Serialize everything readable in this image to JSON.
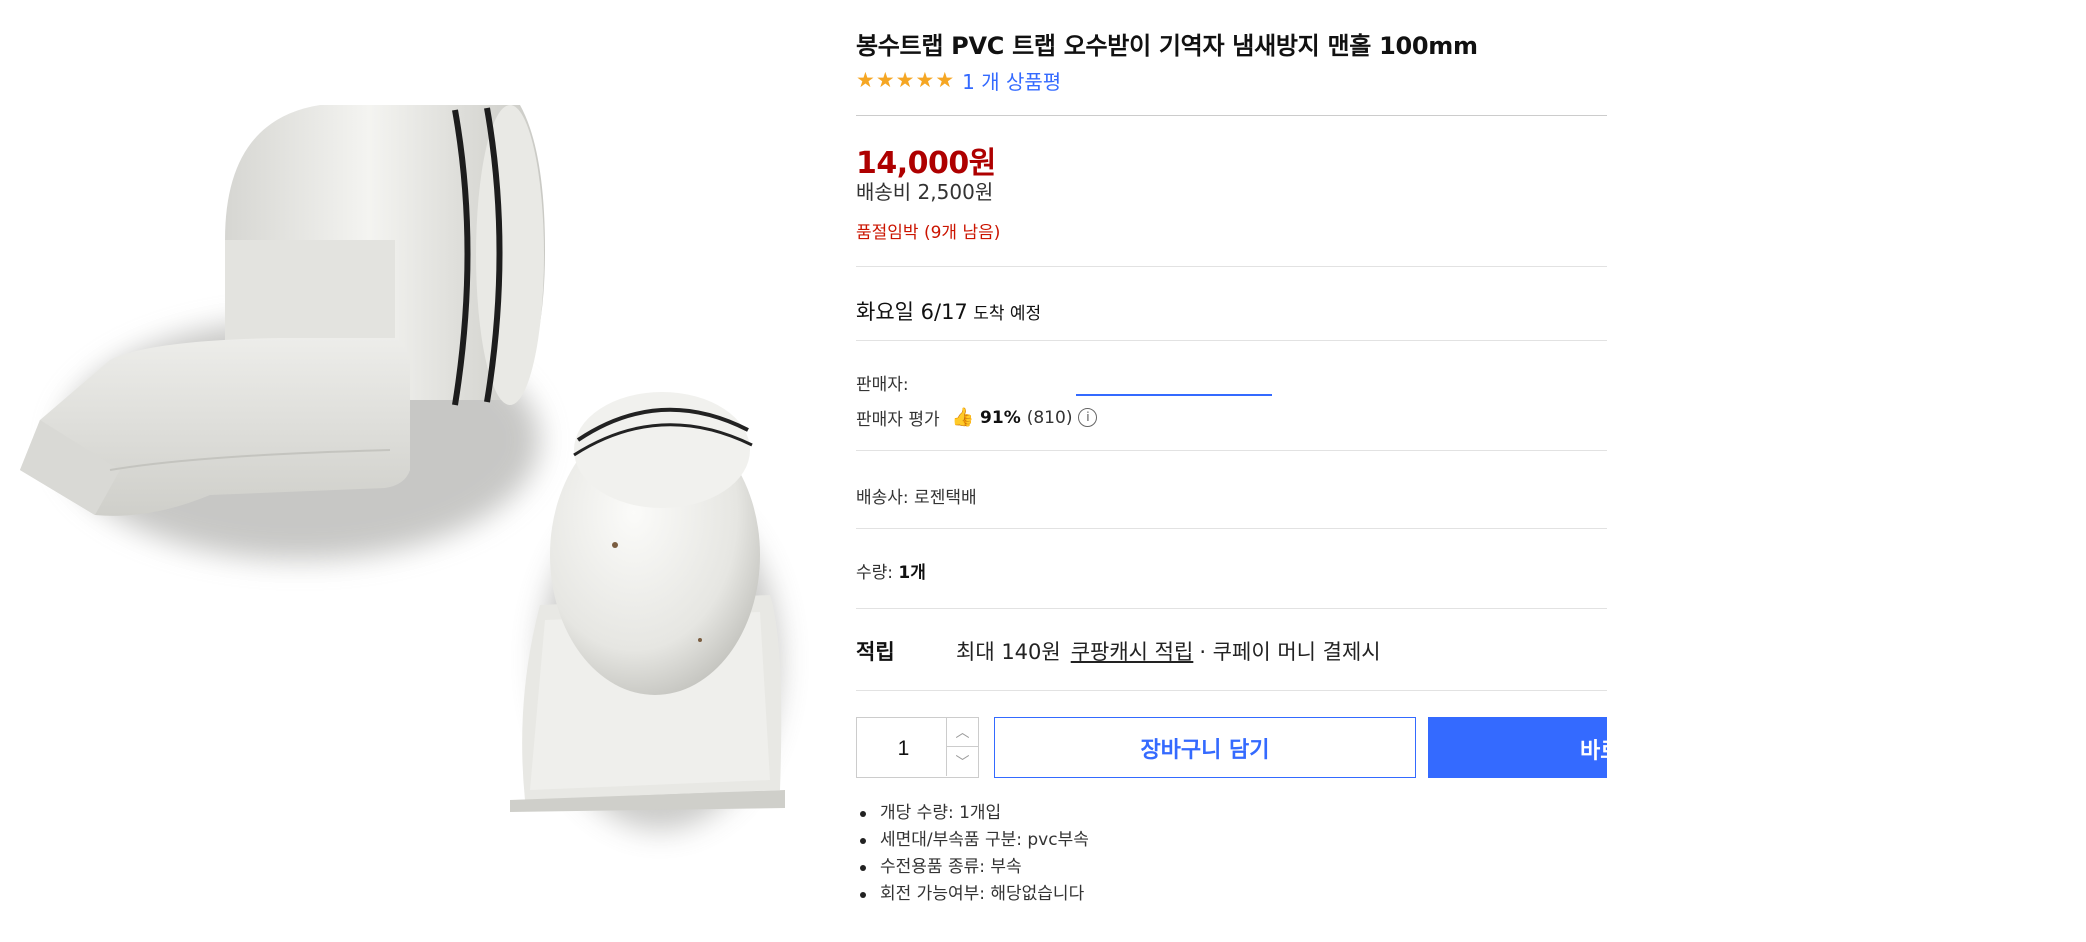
{
  "product": {
    "title": "봉수트랩 PVC 트랩 오수받이 기역자 냄새방지 맨홀 100mm",
    "rating_stars": 5,
    "review_link": "1 개 상품평",
    "price": "14,000원",
    "shipping_fee": "배송비 2,500원",
    "stock_warning": "품절임박 (9개 남음)"
  },
  "delivery": {
    "day": "화요일 6/17",
    "suffix": " 도착 예정"
  },
  "seller": {
    "label": "판매자:",
    "rating_label": "판매자 평가",
    "rating_percent": "91%",
    "rating_count": "(810)",
    "courier": "배송사:  로젠택배"
  },
  "order": {
    "quantity_text_label": "수량: ",
    "quantity_text_value": "1개",
    "quantity_value": "1",
    "add_to_cart": "장바구니 담기",
    "buy_now": "바로구매"
  },
  "cash": {
    "title": "적립",
    "prefix": "최대 140원",
    "link": "쿠팡캐시 적립",
    "suffix": "· 쿠페이 머니 결제시"
  },
  "specs": [
    "개당 수량: 1개입",
    "세면대/부속품 구분: pvc부속",
    "수전용품 종류: 부속",
    "회전 가능여부: 해당없습니다"
  ],
  "icons": {
    "star": "star-icon",
    "thumb": "thumbs-up-icon",
    "info": "info-icon",
    "up": "chevron-up-icon",
    "down": "chevron-down-icon"
  },
  "colors": {
    "accent": "#346aff",
    "price": "#ae0000",
    "stock": "#cb1400",
    "star": "#f5a623"
  }
}
